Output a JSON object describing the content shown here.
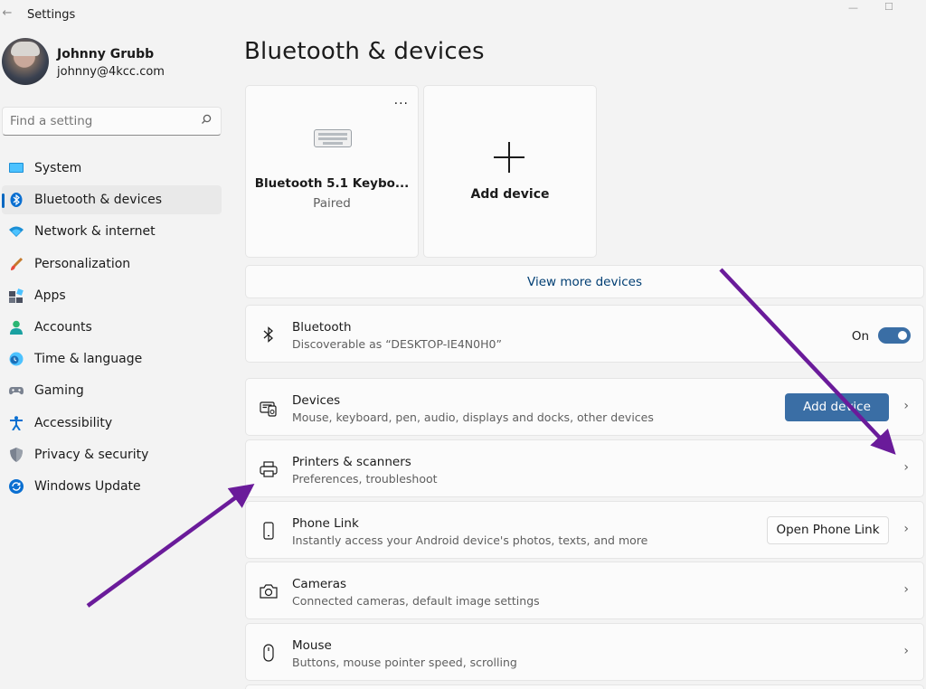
{
  "window": {
    "title": "Settings",
    "back_glyph": "←",
    "minimize_glyph": "—",
    "maximize_glyph": "☐"
  },
  "profile": {
    "name": "Johnny Grubb",
    "email": "johnny@4kcc.com"
  },
  "search": {
    "placeholder": "Find a setting"
  },
  "sidebar": {
    "items": [
      {
        "label": "System",
        "icon": "monitor-icon",
        "active": false
      },
      {
        "label": "Bluetooth & devices",
        "icon": "bluetooth-icon",
        "active": true
      },
      {
        "label": "Network & internet",
        "icon": "wifi-icon",
        "active": false
      },
      {
        "label": "Personalization",
        "icon": "paintbrush-icon",
        "active": false
      },
      {
        "label": "Apps",
        "icon": "apps-icon",
        "active": false
      },
      {
        "label": "Accounts",
        "icon": "person-icon",
        "active": false
      },
      {
        "label": "Time & language",
        "icon": "globe-clock-icon",
        "active": false
      },
      {
        "label": "Gaming",
        "icon": "gamepad-icon",
        "active": false
      },
      {
        "label": "Accessibility",
        "icon": "accessibility-icon",
        "active": false
      },
      {
        "label": "Privacy & security",
        "icon": "shield-icon",
        "active": false
      },
      {
        "label": "Windows Update",
        "icon": "update-icon",
        "active": false
      }
    ]
  },
  "main": {
    "title": "Bluetooth & devices",
    "device_tile": {
      "name": "Bluetooth 5.1 Keybo...",
      "status": "Paired",
      "more_glyph": "..."
    },
    "add_tile": {
      "label": "Add device"
    },
    "view_more": "View more devices",
    "bluetooth": {
      "title": "Bluetooth",
      "subtitle": "Discoverable as “DESKTOP-IE4N0H0”",
      "toggle_label": "On",
      "toggle_on": true
    },
    "devices": {
      "title": "Devices",
      "subtitle": "Mouse, keyboard, pen, audio, displays and docks, other devices",
      "button": "Add device"
    },
    "printers": {
      "title": "Printers & scanners",
      "subtitle": "Preferences, troubleshoot"
    },
    "phone": {
      "title": "Phone Link",
      "subtitle": "Instantly access your Android device's photos, texts, and more",
      "button": "Open Phone Link"
    },
    "cameras": {
      "title": "Cameras",
      "subtitle": "Connected cameras, default image settings"
    },
    "mouse": {
      "title": "Mouse",
      "subtitle": "Buttons, mouse pointer speed, scrolling"
    },
    "chevron_glyph": "›"
  },
  "colors": {
    "accent": "#3a6ea5",
    "annotation_arrow": "#6a1b9a"
  }
}
